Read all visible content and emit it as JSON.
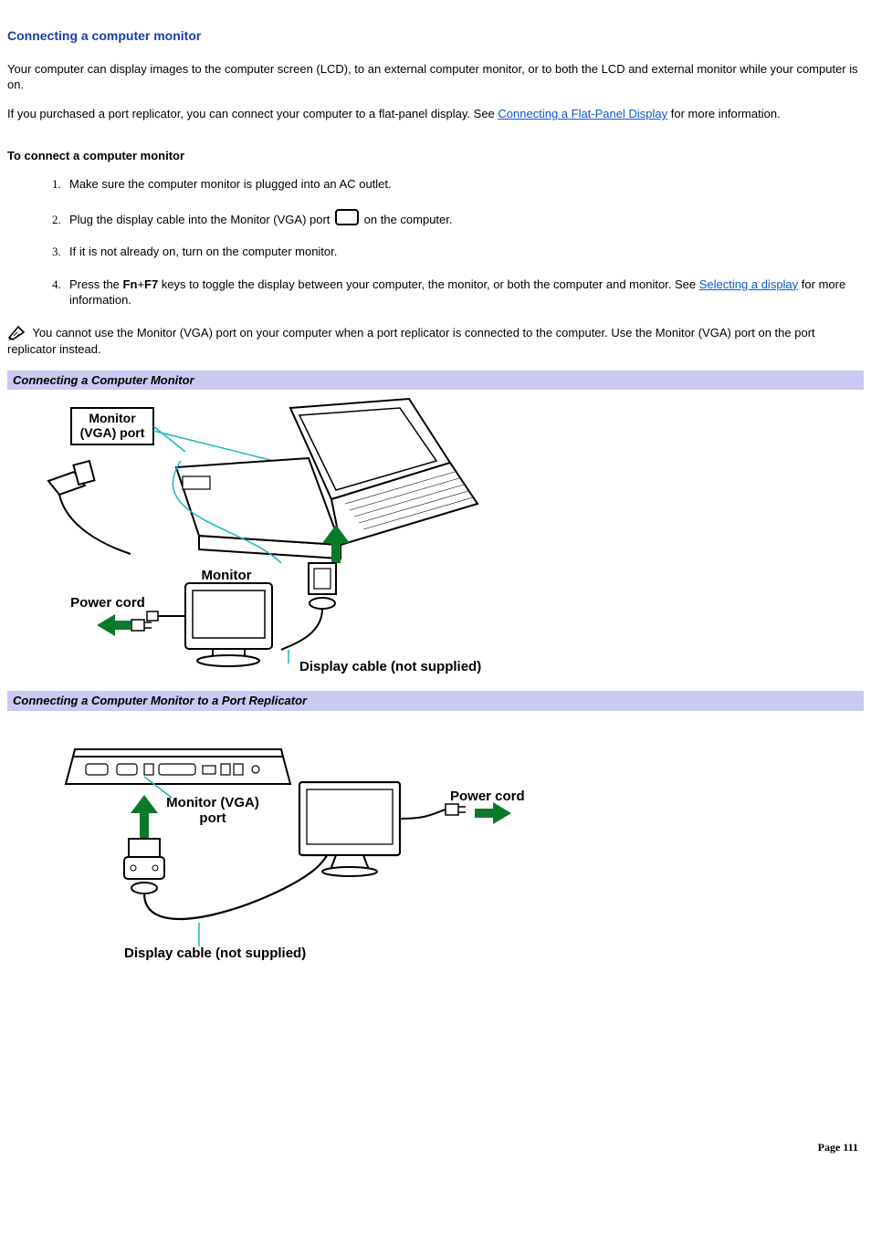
{
  "heading": "Connecting a computer monitor",
  "para1": "Your computer can display images to the computer screen (LCD), to an external computer monitor, or to both the LCD and external monitor while your computer is on.",
  "para2_pre": "If you purchased a port replicator, you can connect your computer to a flat-panel display. See ",
  "para2_link": "Connecting a Flat-Panel Display",
  "para2_post": " for more information.",
  "subhead": "To connect a computer monitor",
  "steps": {
    "s1": "Make sure the computer monitor is plugged into an AC outlet.",
    "s2_pre": "Plug the display cable into the Monitor (VGA) port ",
    "s2_post": " on the computer.",
    "s3": "If it is not already on, turn on the computer monitor.",
    "s4_pre": "Press the ",
    "s4_key1": "Fn",
    "s4_plus": "+",
    "s4_key2": "F7",
    "s4_mid": " keys to toggle the display between your computer, the monitor, or both the computer and monitor. See ",
    "s4_link": "Selecting a display",
    "s4_post": " for more information."
  },
  "note": "You cannot use the Monitor (VGA) port on your computer when a port replicator is connected to the computer. Use the Monitor (VGA) port on the port replicator instead.",
  "caption1": "Connecting a Computer Monitor",
  "fig1": {
    "vga_label_l1": "Monitor",
    "vga_label_l2": "(VGA) port",
    "monitor_label": "Monitor",
    "power_label": "Power cord",
    "cable_label": "Display cable (not supplied)"
  },
  "caption2": "Connecting a Computer Monitor to a Port Replicator",
  "fig2": {
    "vga_label_l1": "Monitor (VGA)",
    "vga_label_l2": "port",
    "power_label": "Power cord",
    "cable_label": "Display cable (not supplied)"
  },
  "page_label": "Page 111"
}
